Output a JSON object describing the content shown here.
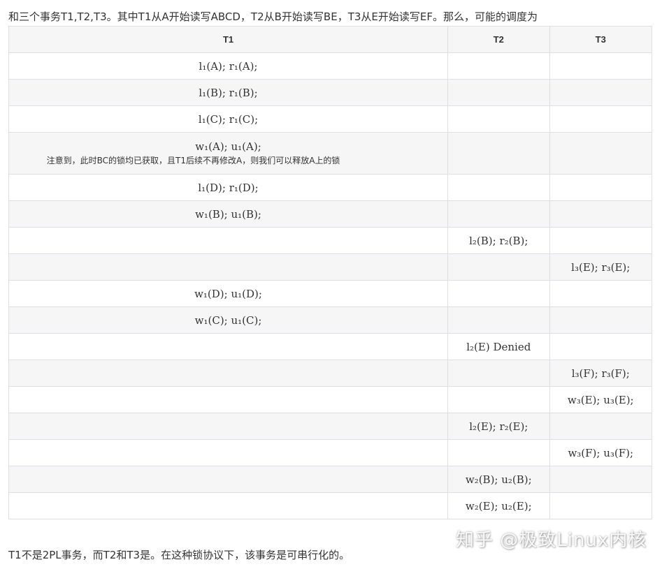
{
  "intro_text": "和三个事务T1,T2,T3。其中T1从A开始读写ABCD，T2从B开始读写BE，T3从E开始读写EF。那么，可能的调度为",
  "table": {
    "headers": [
      "T1",
      "T2",
      "T3"
    ],
    "rows": [
      {
        "t1": "l₁(A); r₁(A);",
        "t2": "",
        "t3": ""
      },
      {
        "t1": "l₁(B); r₁(B);",
        "t2": "",
        "t3": ""
      },
      {
        "t1": "l₁(C); r₁(C);",
        "t2": "",
        "t3": ""
      },
      {
        "t1": "w₁(A); u₁(A);",
        "t1_note": "注意到，此时BC的锁均已获取，且T1后续不再修改A，则我们可以释放A上的锁",
        "t2": "",
        "t3": ""
      },
      {
        "t1": "l₁(D); r₁(D);",
        "t2": "",
        "t3": ""
      },
      {
        "t1": "w₁(B); u₁(B);",
        "t2": "",
        "t3": ""
      },
      {
        "t1": "",
        "t2": "l₂(B); r₂(B);",
        "t3": ""
      },
      {
        "t1": "",
        "t2": "",
        "t3": "l₃(E); r₃(E);"
      },
      {
        "t1": "w₁(D); u₁(D);",
        "t2": "",
        "t3": ""
      },
      {
        "t1": "w₁(C); u₁(C);",
        "t2": "",
        "t3": ""
      },
      {
        "t1": "",
        "t2": "l₂(E) Denied",
        "t3": ""
      },
      {
        "t1": "",
        "t2": "",
        "t3": "l₃(F); r₃(F);"
      },
      {
        "t1": "",
        "t2": "",
        "t3": "w₃(E); u₃(E);"
      },
      {
        "t1": "",
        "t2": "l₂(E); r₂(E);",
        "t3": ""
      },
      {
        "t1": "",
        "t2": "",
        "t3": "w₃(F); u₃(F);"
      },
      {
        "t1": "",
        "t2": "w₂(B); u₂(B);",
        "t3": ""
      },
      {
        "t1": "",
        "t2": "w₂(E); u₂(E);",
        "t3": ""
      }
    ]
  },
  "conclusion_text": "T1不是2PL事务，而T2和T3是。在这种锁协议下，该事务是可串行化的。",
  "watermark_text": "知乎 @极致Linux内核"
}
